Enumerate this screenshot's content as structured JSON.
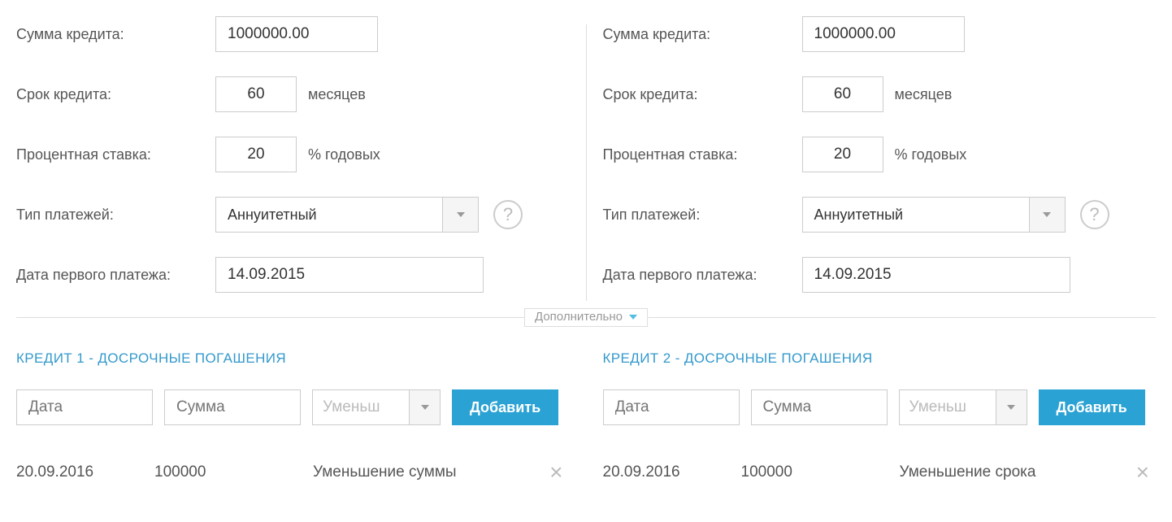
{
  "labels": {
    "amount": "Сумма кредита:",
    "term": "Срок кредита:",
    "term_suffix": "месяцев",
    "rate": "Процентная ставка:",
    "rate_suffix": "% годовых",
    "payment_type": "Тип платежей:",
    "first_payment": "Дата первого платежа:"
  },
  "credit1": {
    "amount": "1000000.00",
    "term": "60",
    "rate": "20",
    "payment_type_value": "Аннуитетный",
    "first_payment_date": "14.09.2015"
  },
  "credit2": {
    "amount": "1000000.00",
    "term": "60",
    "rate": "20",
    "payment_type_value": "Аннуитетный",
    "first_payment_date": "14.09.2015"
  },
  "middle": {
    "label": "Дополнительно"
  },
  "prepay": {
    "title1": "КРЕДИТ 1 - ДОСРОЧНЫЕ ПОГАШЕНИЯ",
    "title2": "КРЕДИТ 2 - ДОСРОЧНЫЕ ПОГАШЕНИЯ",
    "date_ph": "Дата",
    "sum_ph": "Сумма",
    "type_ph": "Уменьш",
    "add_btn": "Добавить"
  },
  "entry1": {
    "date": "20.09.2016",
    "sum": "100000",
    "type": "Уменьшение суммы"
  },
  "entry2": {
    "date": "20.09.2016",
    "sum": "100000",
    "type": "Уменьшение срока"
  }
}
